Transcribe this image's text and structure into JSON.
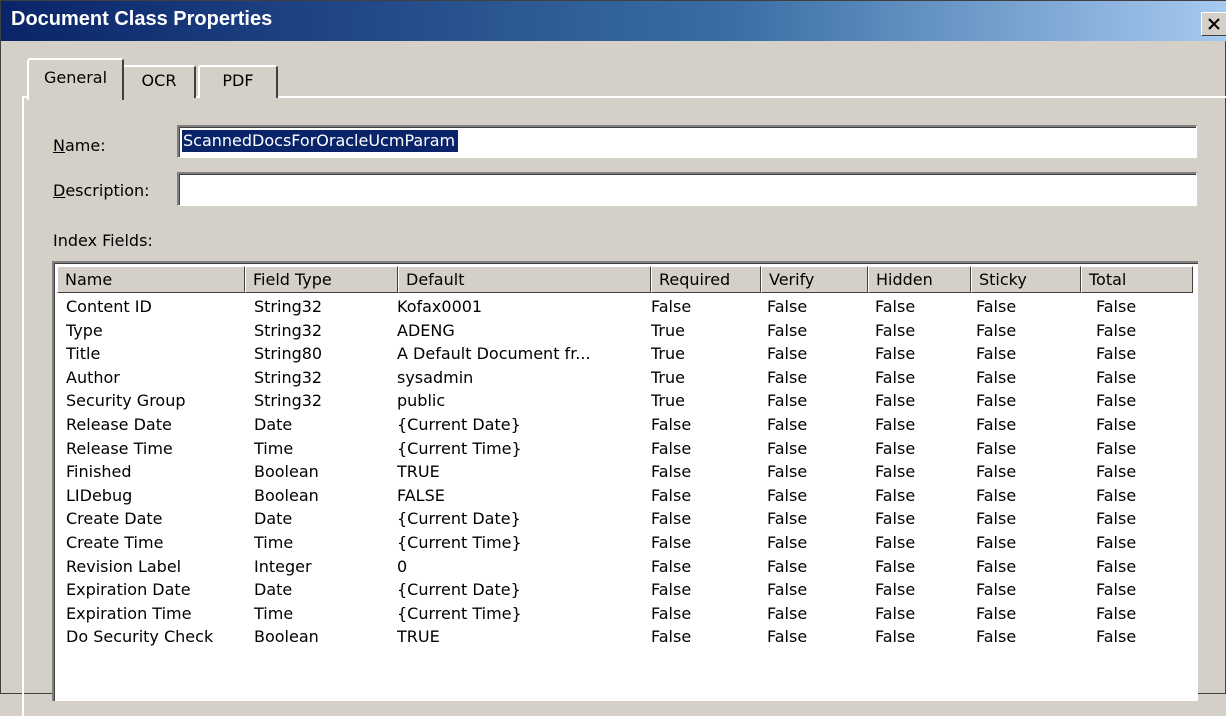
{
  "window": {
    "title": "Document Class Properties"
  },
  "tabs": [
    {
      "label": "General"
    },
    {
      "label": "OCR"
    },
    {
      "label": "PDF"
    }
  ],
  "form": {
    "name_label": "Name:",
    "name_value": "ScannedDocsForOracleUcmParam",
    "description_label": "Description:",
    "description_value": "",
    "index_fields_label": "Index Fields:"
  },
  "table": {
    "columns": [
      "Name",
      "Field Type",
      "Default",
      "Required",
      "Verify",
      "Hidden",
      "Sticky",
      "Total"
    ],
    "rows": [
      [
        "Content ID",
        "String32",
        "Kofax0001",
        "False",
        "False",
        "False",
        "False",
        "False"
      ],
      [
        "Type",
        "String32",
        "ADENG",
        "True",
        "False",
        "False",
        "False",
        "False"
      ],
      [
        "Title",
        "String80",
        "A Default Document fr...",
        "True",
        "False",
        "False",
        "False",
        "False"
      ],
      [
        "Author",
        "String32",
        "sysadmin",
        "True",
        "False",
        "False",
        "False",
        "False"
      ],
      [
        "Security Group",
        "String32",
        "public",
        "True",
        "False",
        "False",
        "False",
        "False"
      ],
      [
        "Release Date",
        "Date",
        "{Current Date}",
        "False",
        "False",
        "False",
        "False",
        "False"
      ],
      [
        "Release Time",
        "Time",
        "{Current Time}",
        "False",
        "False",
        "False",
        "False",
        "False"
      ],
      [
        "Finished",
        "Boolean",
        "TRUE",
        "False",
        "False",
        "False",
        "False",
        "False"
      ],
      [
        "LIDebug",
        "Boolean",
        "FALSE",
        "False",
        "False",
        "False",
        "False",
        "False"
      ],
      [
        "Create Date",
        "Date",
        "{Current Date}",
        "False",
        "False",
        "False",
        "False",
        "False"
      ],
      [
        "Create Time",
        "Time",
        "{Current Time}",
        "False",
        "False",
        "False",
        "False",
        "False"
      ],
      [
        "Revision Label",
        "Integer",
        "0",
        "False",
        "False",
        "False",
        "False",
        "False"
      ],
      [
        "Expiration Date",
        "Date",
        "{Current Date}",
        "False",
        "False",
        "False",
        "False",
        "False"
      ],
      [
        "Expiration Time",
        "Time",
        "{Current Time}",
        "False",
        "False",
        "False",
        "False",
        "False"
      ],
      [
        "Do Security Check",
        "Boolean",
        "TRUE",
        "False",
        "False",
        "False",
        "False",
        "False"
      ]
    ]
  },
  "icons": {
    "close": "close-icon"
  },
  "colors": {
    "titlebar": "#0a246a",
    "selection": "#0a246a",
    "face": "#d4d0c8"
  }
}
